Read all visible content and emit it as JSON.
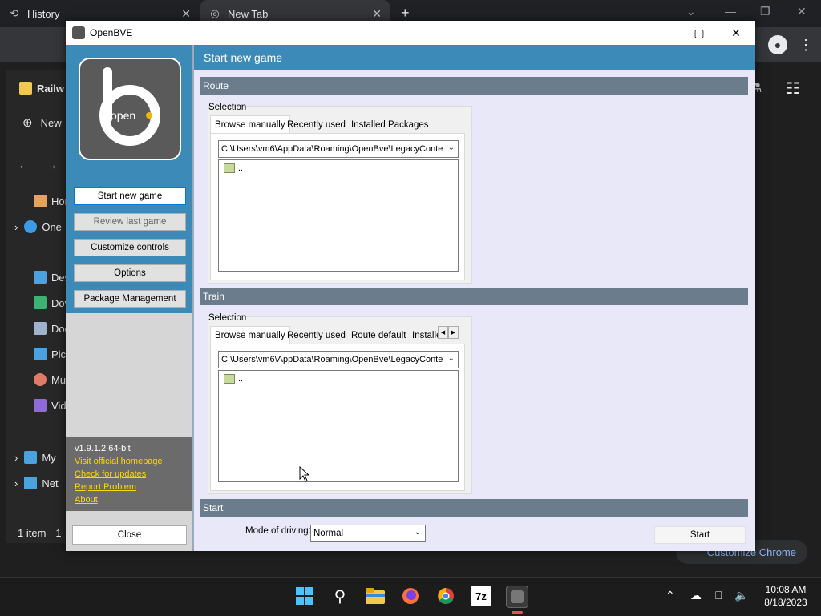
{
  "chrome": {
    "tabs": [
      {
        "title": "History",
        "icon": "history-icon"
      },
      {
        "title": "New Tab",
        "icon": "chrome-icon"
      }
    ],
    "new_tab": "+",
    "customize_label": "Customize Chrome"
  },
  "explorer": {
    "title_partial": "Railw",
    "new_label": "New",
    "items": [
      "Hor",
      "One",
      "Des",
      "Dov",
      "Doc",
      "Pict",
      "Mu",
      "Vide",
      "My",
      "Net"
    ],
    "status": "1 item",
    "status_sep": "1"
  },
  "openbve": {
    "window_title": "OpenBVE",
    "logo_text": "open",
    "menu": {
      "start_new_game": "Start new game",
      "review_last_game": "Review last game",
      "customize_controls": "Customize controls",
      "options": "Options",
      "package_management": "Package Management"
    },
    "version": "v1.9.1.2 64-bit",
    "links": {
      "homepage": "Visit official homepage",
      "updates": "Check for updates",
      "report": "Report Problem",
      "about": "About"
    },
    "close_label": "Close",
    "page_title": "Start new game",
    "route": {
      "header": "Route",
      "selection_label": "Selection",
      "tabs": [
        "Browse manually",
        "Recently used",
        "Installed Packages"
      ],
      "path": "C:\\Users\\vm6\\AppData\\Roaming\\OpenBve\\LegacyConte",
      "list_item": ".."
    },
    "train": {
      "header": "Train",
      "selection_label": "Selection",
      "tabs": [
        "Browse manually",
        "Recently used",
        "Route default",
        "Installe"
      ],
      "path": "C:\\Users\\vm6\\AppData\\Roaming\\OpenBve\\LegacyConte",
      "list_item": ".."
    },
    "start": {
      "header": "Start",
      "mode_label": "Mode of driving:",
      "mode_value": "Normal",
      "start_label": "Start"
    }
  },
  "taskbar": {
    "time": "10:08 AM",
    "date": "8/18/2023",
    "sevenzip": "7z"
  }
}
